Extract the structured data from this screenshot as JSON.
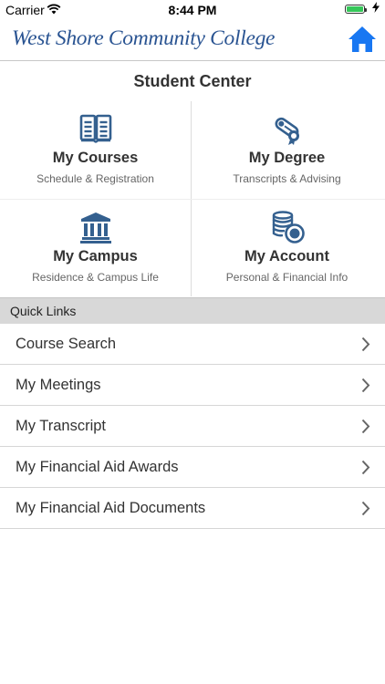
{
  "status_bar": {
    "carrier": "Carrier",
    "time": "8:44 PM",
    "battery_level": 1.0,
    "charging": true,
    "icons": [
      "wifi-icon",
      "battery-icon",
      "charging-bolt-icon"
    ]
  },
  "header": {
    "college_name": "West Shore Community College",
    "home_icon": "home-icon"
  },
  "student_center": {
    "title": "Student Center",
    "tiles": [
      {
        "title": "My Courses",
        "subtitle": "Schedule & Registration",
        "icon": "open-book-icon"
      },
      {
        "title": "My Degree",
        "subtitle": "Transcripts & Advising",
        "icon": "diploma-icon"
      },
      {
        "title": "My Campus",
        "subtitle": "Residence & Campus Life",
        "icon": "building-columns-icon"
      },
      {
        "title": "My Account",
        "subtitle": "Personal & Financial Info",
        "icon": "coins-icon"
      }
    ]
  },
  "quick_links": {
    "header": "Quick Links",
    "items": [
      {
        "label": "Course Search"
      },
      {
        "label": "My Meetings"
      },
      {
        "label": "My Transcript"
      },
      {
        "label": "My Financial Aid Awards"
      },
      {
        "label": "My Financial Aid Documents"
      }
    ]
  },
  "colors": {
    "brand_blue": "#2a5492",
    "icon_blue": "#34608f",
    "home_blue": "#1877f2",
    "battery_green": "#35c759",
    "quick_links_bg": "#d8d8d8"
  }
}
